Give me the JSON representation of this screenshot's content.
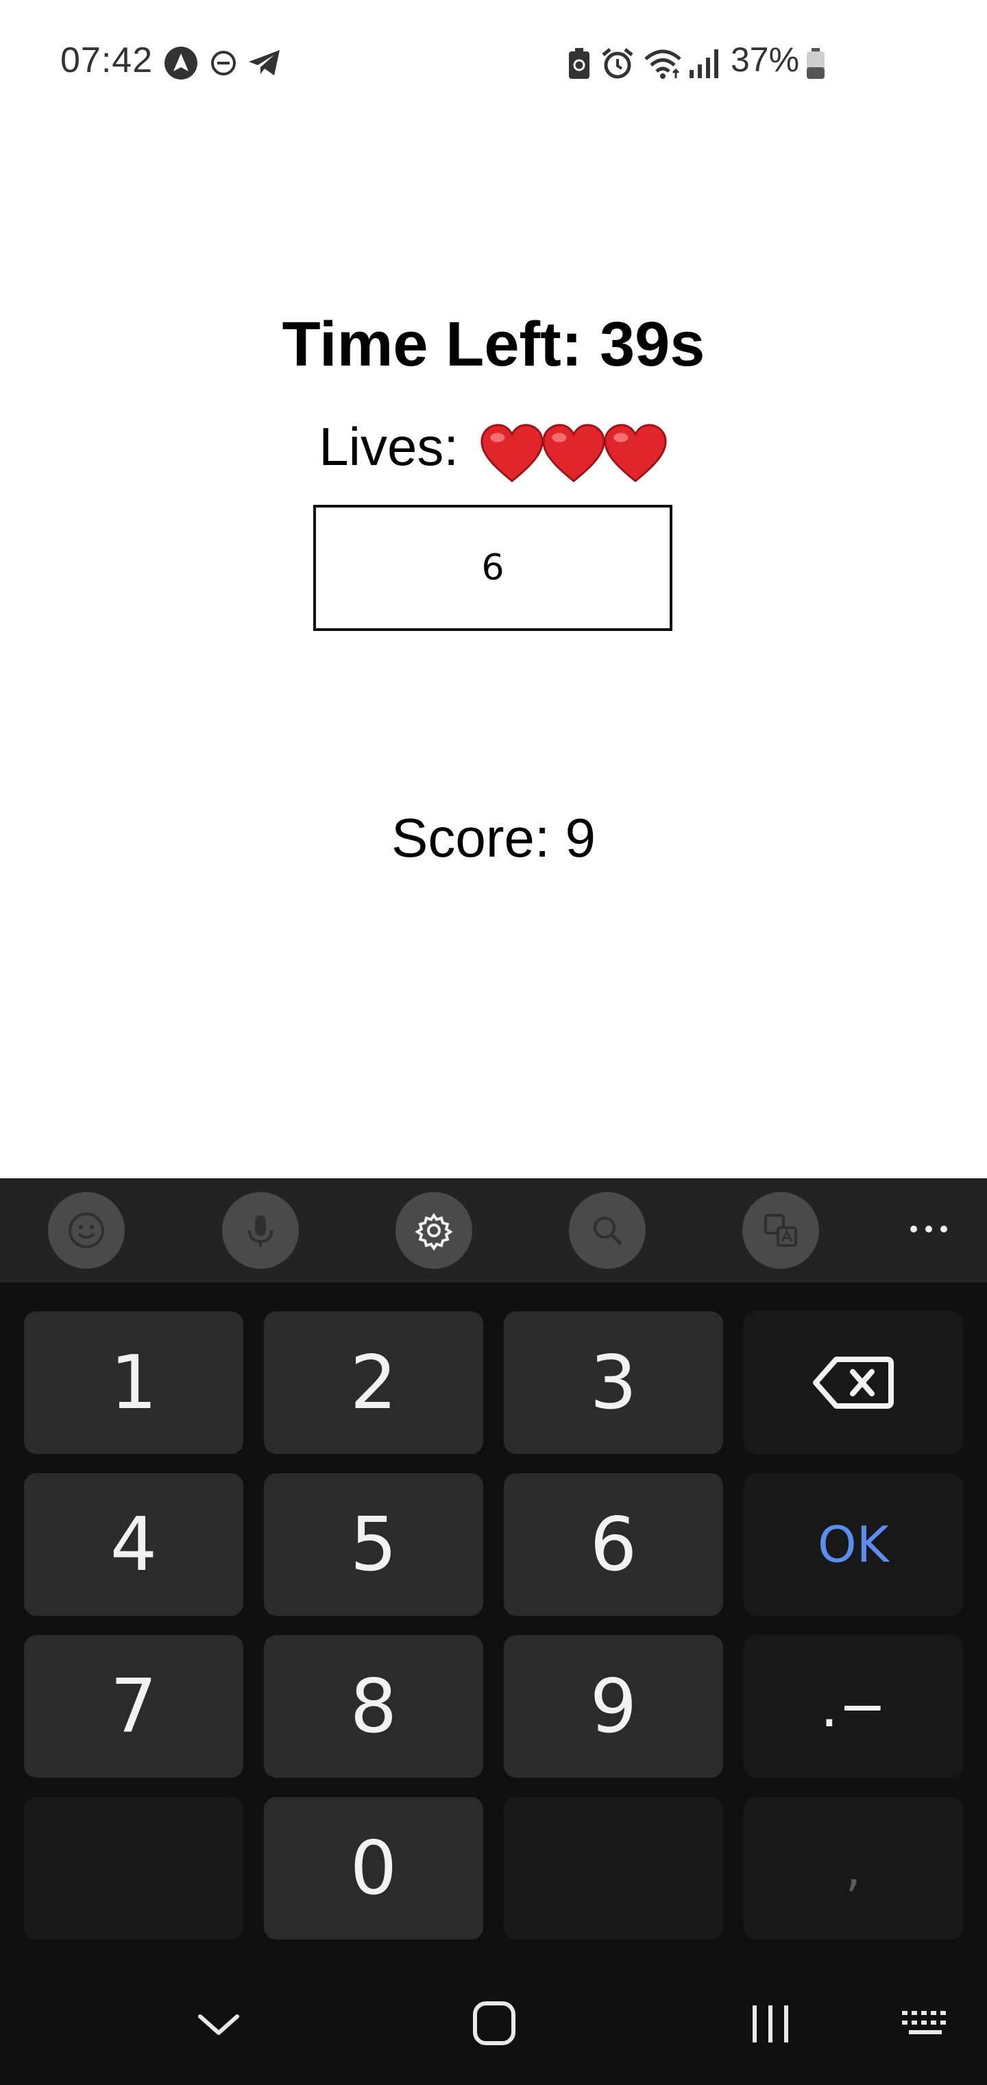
{
  "status_bar": {
    "time": "07:42",
    "battery_percent": "37%",
    "left_icons": [
      "navigation-icon",
      "do-not-disturb-icon",
      "telegram-icon"
    ],
    "right_icons": [
      "battery-saver-icon",
      "alarm-icon",
      "wifi-icon",
      "signal-icon",
      "battery-icon"
    ]
  },
  "game": {
    "time_left": "Time Left: 39s",
    "lives_label": "Lives:",
    "lives_count": 3,
    "answer_value": "6",
    "score": "Score: 9",
    "heart_color": "#e0252b"
  },
  "keyboard_toolbar": {
    "buttons": [
      "emoji-icon",
      "microphone-icon",
      "settings-icon",
      "search-icon",
      "translate-icon",
      "more-icon"
    ]
  },
  "keyboard": {
    "keys": {
      "k1": "1",
      "k2": "2",
      "k3": "3",
      "k4": "4",
      "k5": "5",
      "k6": "6",
      "k7": "7",
      "k8": "8",
      "k9": "9",
      "k0": "0",
      "ok": "OK",
      "dot_dash": ".−",
      "comma": ","
    },
    "accent_color": "#5b8def"
  },
  "nav_bar": {
    "icons": [
      "hide-keyboard-icon",
      "home-icon",
      "recents-icon",
      "keyboard-switch-icon"
    ]
  }
}
